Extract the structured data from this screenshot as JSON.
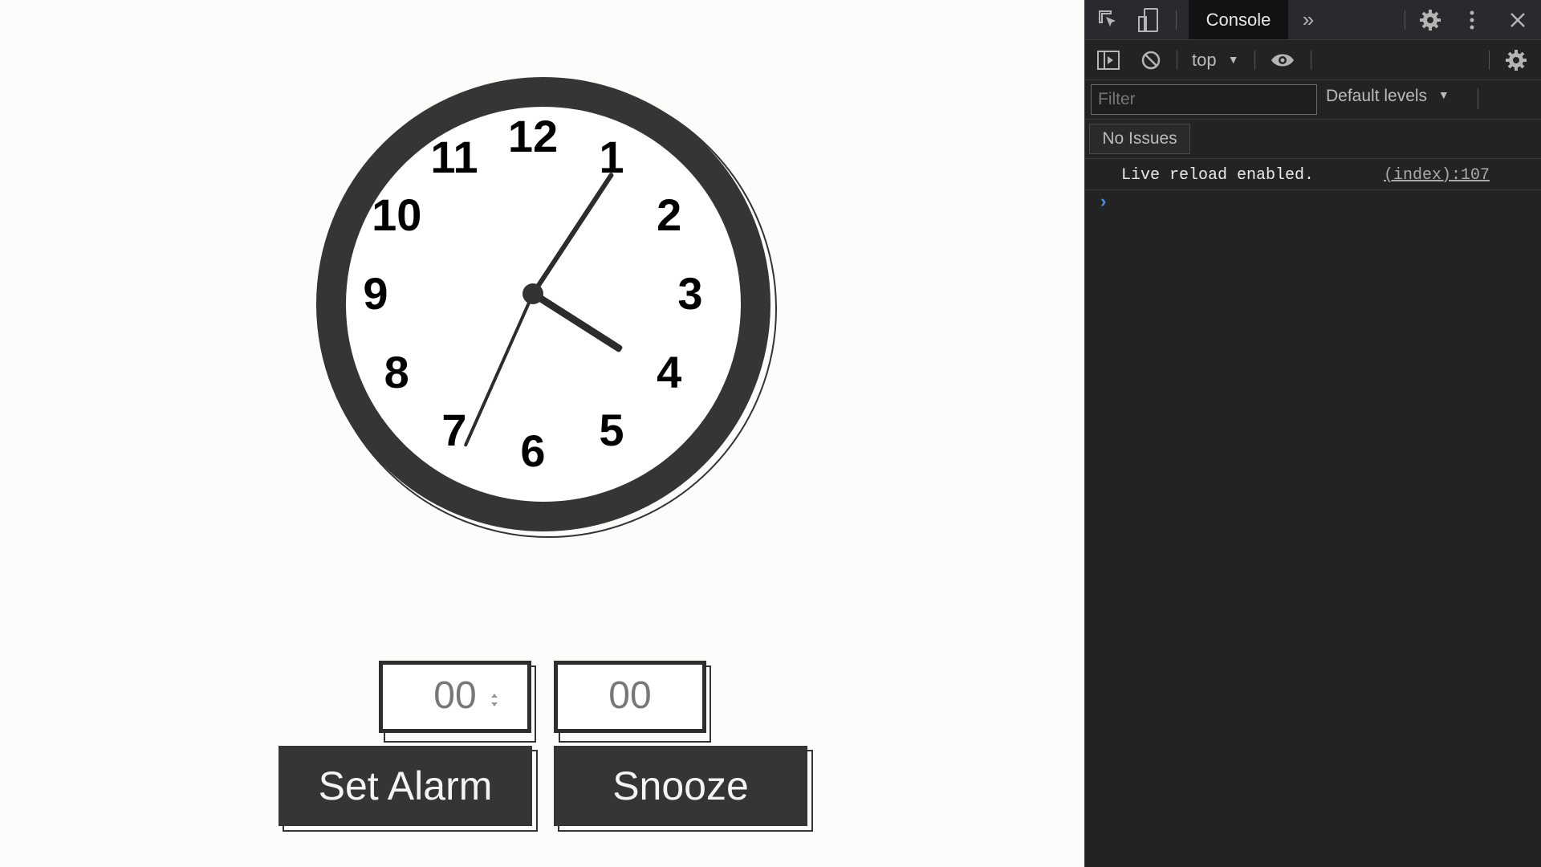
{
  "clock": {
    "numerals": [
      "12",
      "1",
      "2",
      "3",
      "4",
      "5",
      "6",
      "7",
      "8",
      "9",
      "10",
      "11"
    ],
    "time": {
      "hour": 4,
      "minute": 5,
      "second": 34
    }
  },
  "alarm": {
    "hours_placeholder": "00",
    "minutes_placeholder": "00",
    "set_alarm_label": "Set Alarm",
    "snooze_label": "Snooze"
  },
  "devtools": {
    "active_tab": "Console",
    "context": "top",
    "filter_placeholder": "Filter",
    "levels_label": "Default levels",
    "issues_label": "No Issues",
    "log_message": "Live reload enabled.",
    "log_source": "(index):107",
    "prompt_glyph": "›",
    "more_tabs_glyph": "»"
  },
  "colors": {
    "clock_ring": "#353535",
    "button_bg": "#353535",
    "devtools_bg": "#232324",
    "prompt": "#4a8fe7"
  }
}
